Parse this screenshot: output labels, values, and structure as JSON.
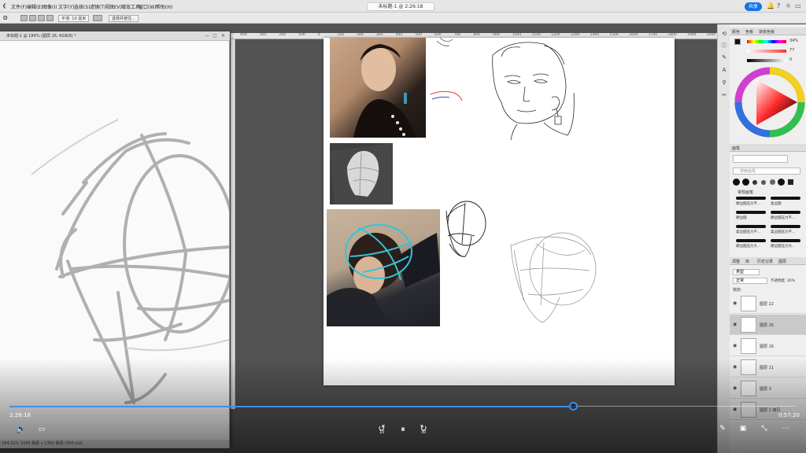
{
  "menubar": {
    "items": [
      "文件(F)",
      "编辑(E)",
      "图像(I)",
      "文字(Y)",
      "选择(S)",
      "滤镜(T)",
      "视图(V)",
      "增效工具",
      "窗口(W)",
      "帮助(H)"
    ],
    "document_title": "未标题-1 @ 2:26:18",
    "share_label": "共享"
  },
  "options_bar": {
    "smooth_label": "平滑: 10 毫米",
    "select_subject_label": "选择并遮住..."
  },
  "doc_window": {
    "tab_label": "未标题-1 @ 184% (图层 26, RGB/8) *",
    "status_text": "184.32% 1945 像素 x 1362 像素 (300 ppi)"
  },
  "ruler": {
    "ticks": [
      "400",
      "300",
      "200",
      "100",
      "0",
      "100",
      "200",
      "300",
      "400",
      "500",
      "600",
      "700",
      "800",
      "900",
      "1000",
      "1100",
      "1200",
      "1300",
      "1400",
      "1500",
      "1600",
      "1700",
      "1800",
      "1900",
      "2000"
    ]
  },
  "panels": {
    "color_tabs": [
      "颜色",
      "色板",
      "渐变色板"
    ],
    "color_values": {
      "h": "34%",
      "s": "77",
      "b": "0"
    },
    "brush_tabs": [
      "画笔"
    ],
    "brush_search_placeholder": "搜索画笔",
    "brush_group_label": "常规画笔",
    "brushes": [
      [
        "硬边圆压力不...",
        "柔边圆"
      ],
      [
        "硬边圆",
        "硬边圆压力不..."
      ],
      [
        "柔边圆压力不...",
        "柔边圆压力不..."
      ],
      [
        "硬边圆压力大...",
        "硬边圆压力大..."
      ]
    ],
    "layer_tabs": [
      "调整",
      "库",
      "历史记录",
      "图层"
    ],
    "layer_kind_label": "类型",
    "blend_mode": "正常",
    "opacity_label": "不透明度: 20%",
    "lock_label": "锁定:",
    "layers": [
      "图层 22",
      "图层 26",
      "图层 16",
      "图层 11",
      "图层 3",
      "图层 1 拷贝"
    ]
  },
  "video": {
    "elapsed": "2:26:18",
    "remaining": "0:57:20",
    "progress": 0.716,
    "skip_back_label": "10",
    "skip_forward_label": "30"
  }
}
